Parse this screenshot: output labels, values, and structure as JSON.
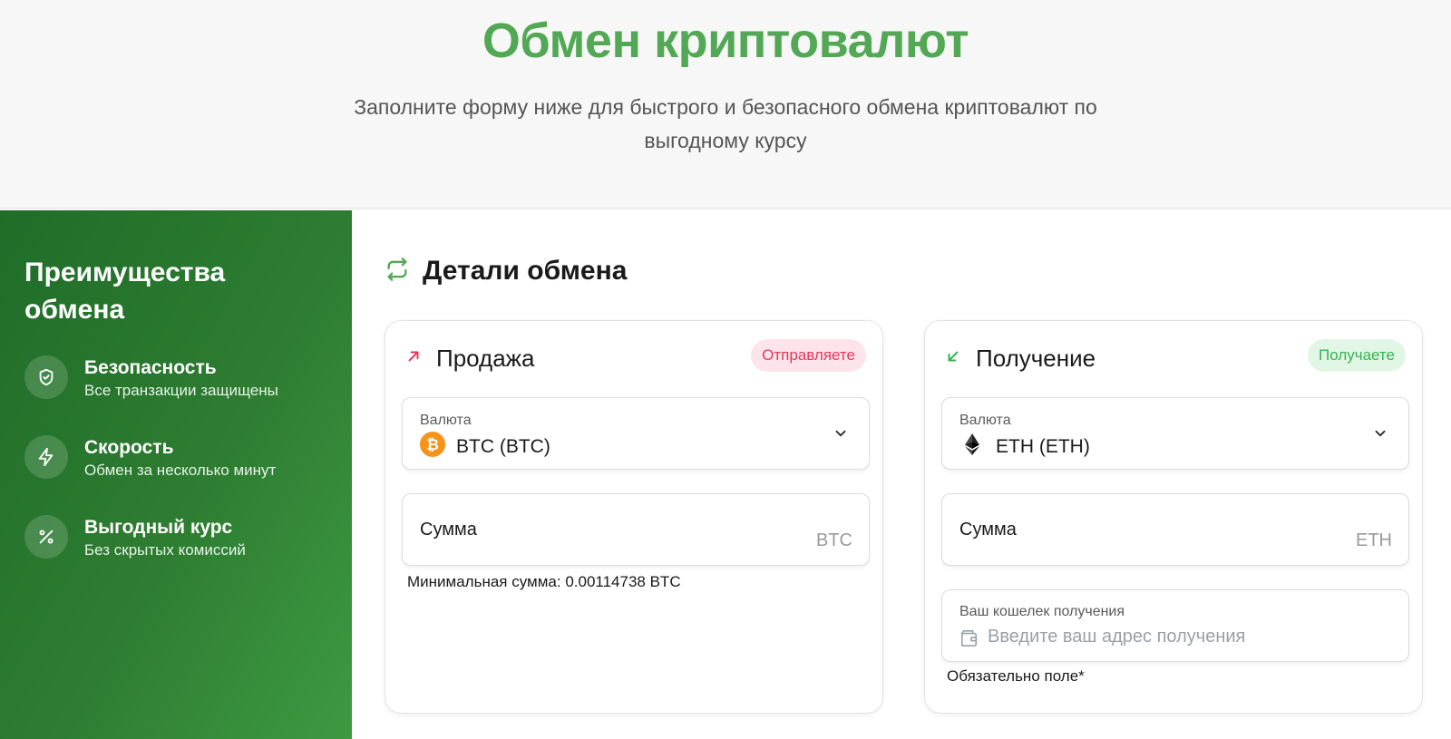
{
  "hero": {
    "title": "Обмен криптовалют",
    "subtitle": "Заполните форму ниже для быстрого и безопасного обмена криптовалют по выгодному курсу"
  },
  "sidebar": {
    "title": "Преимущества обмена",
    "items": [
      {
        "title": "Безопасность",
        "desc": "Все транзакции защищены",
        "icon": "shield-icon"
      },
      {
        "title": "Скорость",
        "desc": "Обмен за несколько минут",
        "icon": "lightning-icon"
      },
      {
        "title": "Выгодный курс",
        "desc": "Без скрытых комиссий",
        "icon": "percent-icon"
      }
    ]
  },
  "main": {
    "section_title": "Детали обмена",
    "sell": {
      "title": "Продажа",
      "badge": "Отправляете",
      "currency_label": "Валюта",
      "currency_value": "BTC (BTC)",
      "amount_label": "Сумма",
      "amount_unit": "BTC",
      "min_note": "Минимальная сумма: 0.00114738 BTC"
    },
    "receive": {
      "title": "Получение",
      "badge": "Получаете",
      "currency_label": "Валюта",
      "currency_value": "ETH (ETH)",
      "amount_label": "Сумма",
      "amount_unit": "ETH",
      "wallet_label": "Ваш кошелек получения",
      "wallet_placeholder": "Введите ваш адрес получения",
      "required_note": "Обязательно поле*"
    }
  },
  "colors": {
    "accent_green": "#52a854",
    "sidebar_green": "#2e7d32",
    "send_pink": "#e8365d",
    "receive_green": "#33b54f",
    "btc_orange": "#f7931a"
  }
}
